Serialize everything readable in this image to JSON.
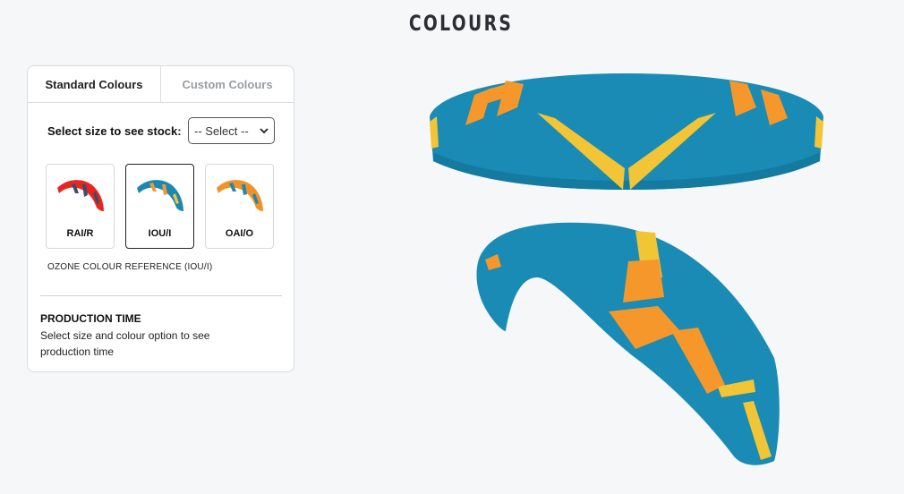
{
  "page": {
    "title": "COLOURS"
  },
  "tabs": [
    {
      "label": "Standard Colours",
      "active": true
    },
    {
      "label": "Custom Colours",
      "active": false
    }
  ],
  "stock": {
    "label": "Select size to see stock:",
    "select_value": "-- Select --"
  },
  "swatches": [
    {
      "code": "RAI/R",
      "selected": false,
      "colors": {
        "base": "#e8261f",
        "accent": "#2d5f8a"
      }
    },
    {
      "code": "IOU/I",
      "selected": true,
      "colors": {
        "base": "#1a87b5",
        "accent": "#f39a2b"
      }
    },
    {
      "code": "OAI/O",
      "selected": false,
      "colors": {
        "base": "#f0922a",
        "accent": "#1a87b5"
      }
    }
  ],
  "reference": "OZONE COLOUR REFERENCE (IOU/I)",
  "production": {
    "title": "PRODUCTION TIME",
    "text": "Select size and colour option to see production time"
  },
  "preview_colors": {
    "teal": "#1a8bb4",
    "orange": "#f5972b",
    "yellow": "#f2c537"
  }
}
